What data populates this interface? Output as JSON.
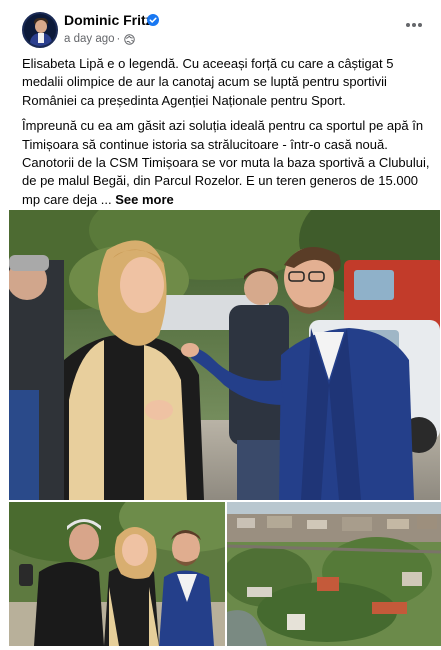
{
  "post": {
    "author": "Dominic Fritz",
    "timestamp": "a day ago",
    "separator": "·",
    "paragraph1": "Elisabeta Lipă e o legendă. Cu aceeași forță cu care a câștigat 5 medalii olimpice de aur la canotaj acum se luptă pentru sportivii României ca președinta Agenției Naționale pentru Sport.",
    "paragraph2": "Împreună cu ea am găsit azi soluția ideală pentru ca sportul pe apă în Timișoara să continue istoria sa strălucitoare - într-o casă nouă. Canotorii de la CSM Timișoara se vor muta la baza sportivă a Clubului, de pe malul Begăi, din Parcul Rozelor. E un teren generos de 15.000 mp care deja ...",
    "see_more": "See more"
  },
  "icons": {
    "verified": "verified-badge-icon",
    "audience": "globe-icon",
    "options": "more-options-icon"
  },
  "colors": {
    "brand": "#1877f2",
    "secondary_text": "#65676b"
  }
}
